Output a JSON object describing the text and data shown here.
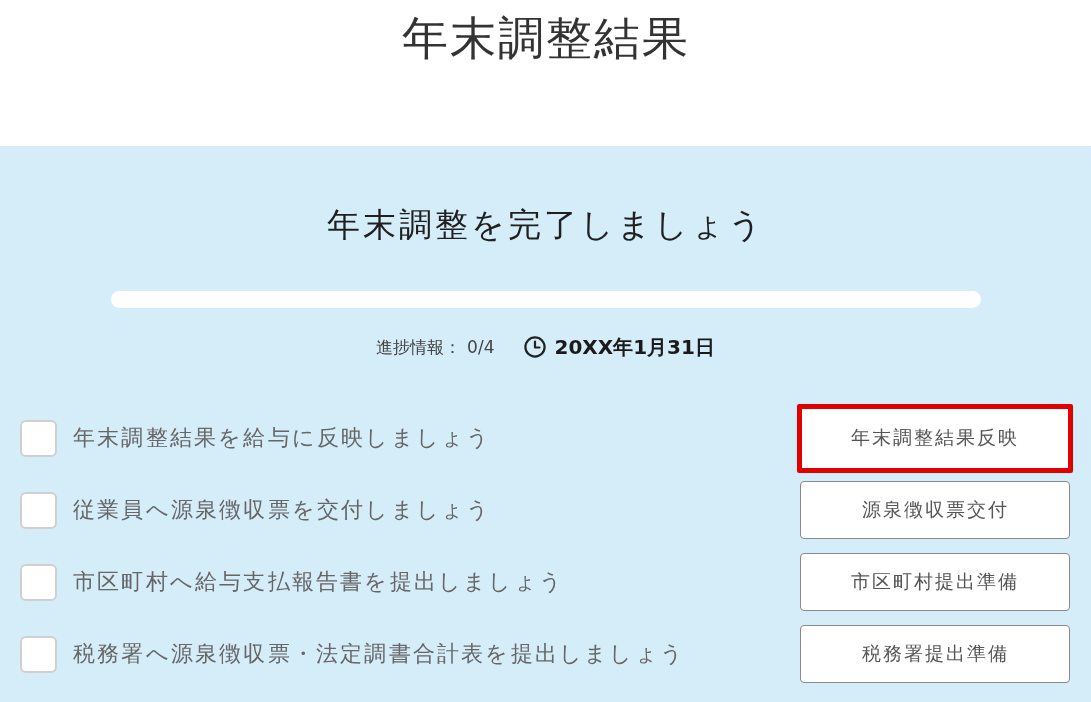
{
  "page_title": "年末調整結果",
  "panel": {
    "heading": "年末調整を完了しましょう",
    "progress_label": "進捗情報：",
    "progress_count": "0/4",
    "deadline": "20XX年1月31日"
  },
  "tasks": [
    {
      "label": "年末調整結果を給与に反映しましょう",
      "checked": false,
      "button": "年末調整結果反映",
      "highlighted": true
    },
    {
      "label": "従業員へ源泉徴収票を交付しましょう",
      "checked": false,
      "button": "源泉徴収票交付",
      "highlighted": false
    },
    {
      "label": "市区町村へ給与支払報告書を提出しましょう",
      "checked": false,
      "button": "市区町村提出準備",
      "highlighted": false
    },
    {
      "label": "税務署へ源泉徴収票・法定調書合計表を提出しましょう",
      "checked": false,
      "button": "税務署提出準備",
      "highlighted": false
    }
  ]
}
